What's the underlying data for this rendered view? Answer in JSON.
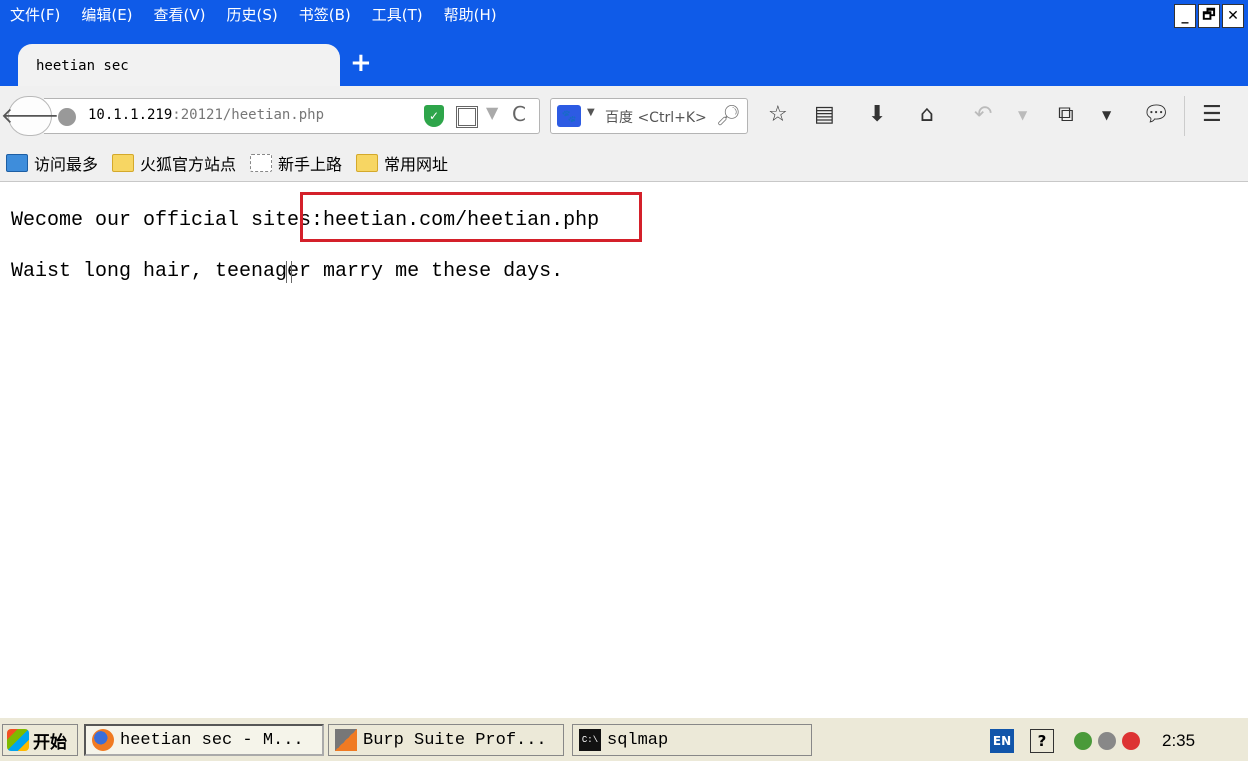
{
  "menubar": {
    "items": [
      "文件(F)",
      "编辑(E)",
      "查看(V)",
      "历史(S)",
      "书签(B)",
      "工具(T)",
      "帮助(H)"
    ]
  },
  "window_controls": {
    "minimize": "_",
    "restore": "🗗",
    "close": "✕"
  },
  "tabs": [
    {
      "title": "heetian sec"
    }
  ],
  "new_tab_label": "+",
  "navbar": {
    "back_glyph": "🡐",
    "url_host": "10.1.1.219",
    "url_rest": ":20121/heetian.php",
    "reload_glyph": "C",
    "search_engine": "百度",
    "search_placeholder": "<Ctrl+K>"
  },
  "bookmarks": [
    {
      "label": "访问最多",
      "icon": "most-visited-icon"
    },
    {
      "label": "火狐官方站点",
      "icon": "folder-icon"
    },
    {
      "label": "新手上路",
      "icon": "page-icon"
    },
    {
      "label": "常用网址",
      "icon": "folder-icon"
    }
  ],
  "page": {
    "line1": "Wecome our official sites:heetian.com/heetian.php",
    "line2": "Waist long hair, teenager marry me these days."
  },
  "taskbar": {
    "start_label": "开始",
    "tasks": [
      {
        "label": "heetian sec - M...",
        "icon": "firefox-icon"
      },
      {
        "label": "Burp Suite Prof...",
        "icon": "burp-icon"
      },
      {
        "label": "sqlmap",
        "icon": "cmd-icon"
      }
    ],
    "lang": "EN",
    "help": "?",
    "clock": "2:35"
  },
  "colors": {
    "chrome_blue": "#0f5be8",
    "highlight_red": "#d4202a",
    "taskbar": "#ece9d8"
  }
}
